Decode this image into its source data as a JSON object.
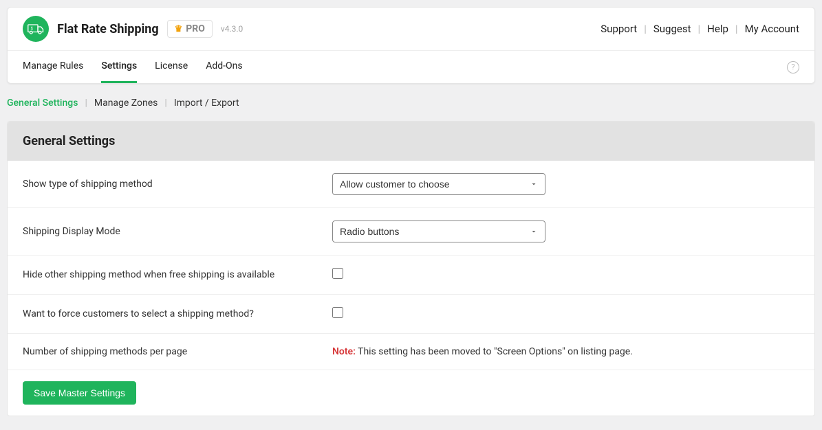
{
  "header": {
    "title": "Flat Rate Shipping",
    "pro_label": "PRO",
    "version": "v4.3.0",
    "links": {
      "support": "Support",
      "suggest": "Suggest",
      "help": "Help",
      "account": "My Account"
    }
  },
  "main_tabs": {
    "manage_rules": "Manage Rules",
    "settings": "Settings",
    "license": "License",
    "addons": "Add-Ons"
  },
  "sub_tabs": {
    "general": "General Settings",
    "zones": "Manage Zones",
    "import_export": "Import / Export"
  },
  "panel": {
    "title": "General Settings"
  },
  "settings": {
    "show_type": {
      "label": "Show type of shipping method",
      "value": "Allow customer to choose"
    },
    "display_mode": {
      "label": "Shipping Display Mode",
      "value": "Radio buttons"
    },
    "hide_other": {
      "label": "Hide other shipping method when free shipping is available"
    },
    "force_select": {
      "label": "Want to force customers to select a shipping method?"
    },
    "per_page": {
      "label": "Number of shipping methods per page",
      "note_prefix": "Note:",
      "note_text": " This setting has been moved to \"Screen Options\" on listing page."
    }
  },
  "footer": {
    "save_label": "Save Master Settings"
  }
}
